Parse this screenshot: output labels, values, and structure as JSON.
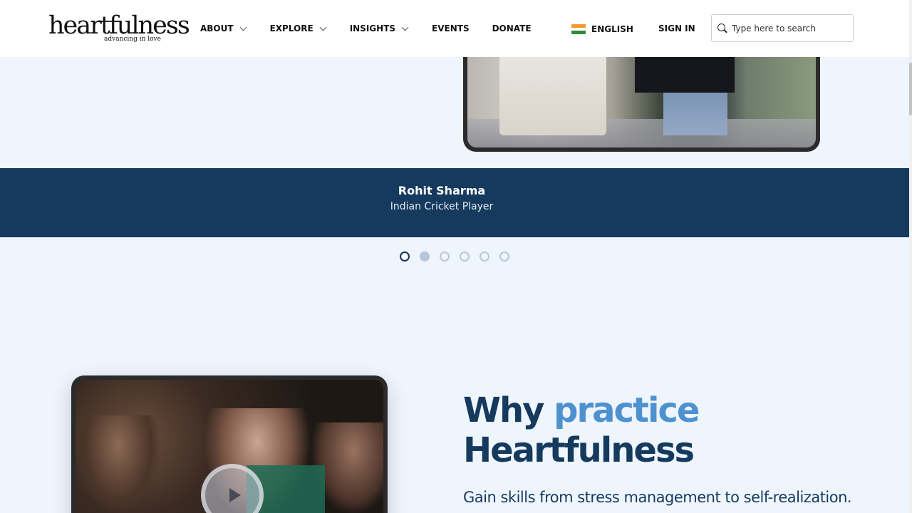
{
  "header": {
    "logo_text": "heartfulness",
    "logo_tagline": "advancing in love",
    "nav": [
      {
        "label": "ABOUT",
        "has_dropdown": true
      },
      {
        "label": "EXPLORE",
        "has_dropdown": true
      },
      {
        "label": "INSIGHTS",
        "has_dropdown": true
      },
      {
        "label": "EVENTS",
        "has_dropdown": false
      },
      {
        "label": "DONATE",
        "has_dropdown": false
      }
    ],
    "language": "ENGLISH",
    "signin": "SIGN IN",
    "search": {
      "placeholder": "Type here to search",
      "value": ""
    }
  },
  "testimonial": {
    "name": "Rohit Sharma",
    "role": "Indian Cricket Player"
  },
  "carousel": {
    "total": 6,
    "active_index": 0
  },
  "why": {
    "title_part1": "Why ",
    "title_accent": "practice",
    "title_part2": "Heartfulness",
    "subtitle": "Gain skills from stress management to self-realization."
  },
  "colors": {
    "background": "#eef5fc",
    "banner": "#163a5e",
    "accent": "#4e91cf",
    "heading": "#163a5e"
  }
}
